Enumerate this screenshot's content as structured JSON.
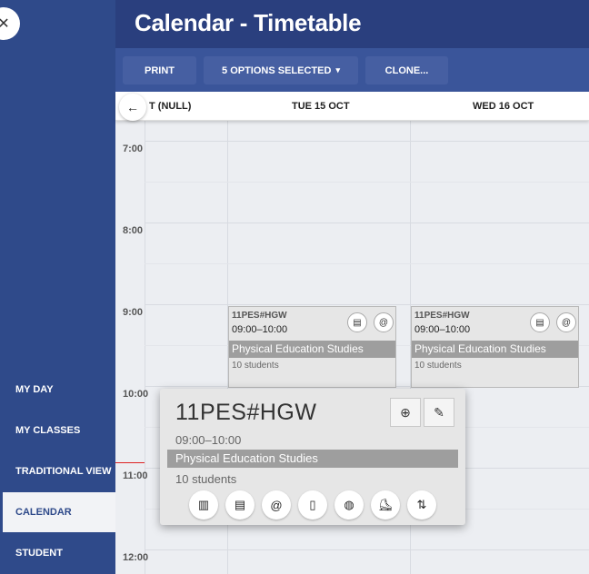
{
  "header": {
    "title": "Calendar - Timetable"
  },
  "toolbar": {
    "print": "PRINT",
    "options": "5 OPTIONS SELECTED",
    "options_caret": "▾",
    "clone": "CLONE..."
  },
  "days": {
    "partial": "T (NULL)",
    "tue": "TUE 15 OCT",
    "wed": "WED 16 OCT"
  },
  "times": [
    "7:00",
    "8:00",
    "9:00",
    "10:00",
    "11:00",
    "12:00"
  ],
  "nav": [
    {
      "label": "MY DAY"
    },
    {
      "label": "MY CLASSES"
    },
    {
      "label": "TRADITIONAL VIEW"
    },
    {
      "label": "CALENDAR"
    },
    {
      "label": "STUDENT"
    }
  ],
  "events": [
    {
      "code": "11PES#HGW",
      "time": "09:00–10:00",
      "subject": "Physical Education Studies",
      "students": "10 students"
    },
    {
      "code": "11PES#HGW",
      "time": "09:00–10:00",
      "subject": "Physical Education Studies",
      "students": "10 students"
    }
  ],
  "popup": {
    "code": "11PES#HGW",
    "time": "09:00–10:00",
    "subject": "Physical Education Studies",
    "students": "10 students"
  },
  "icons": {
    "close": "✕",
    "back": "←",
    "report": "▤",
    "email": "@",
    "add": "⊕",
    "edit": "✎",
    "notebook": "▥",
    "book": "▯",
    "palette": "◍",
    "shoe": "⛸",
    "swap": "⇅"
  },
  "colors": {
    "sidebar": "#2f4a8a",
    "header": "#2a3f7e",
    "toolbar": "#3a559a",
    "subject_bar": "#9e9e9e"
  }
}
